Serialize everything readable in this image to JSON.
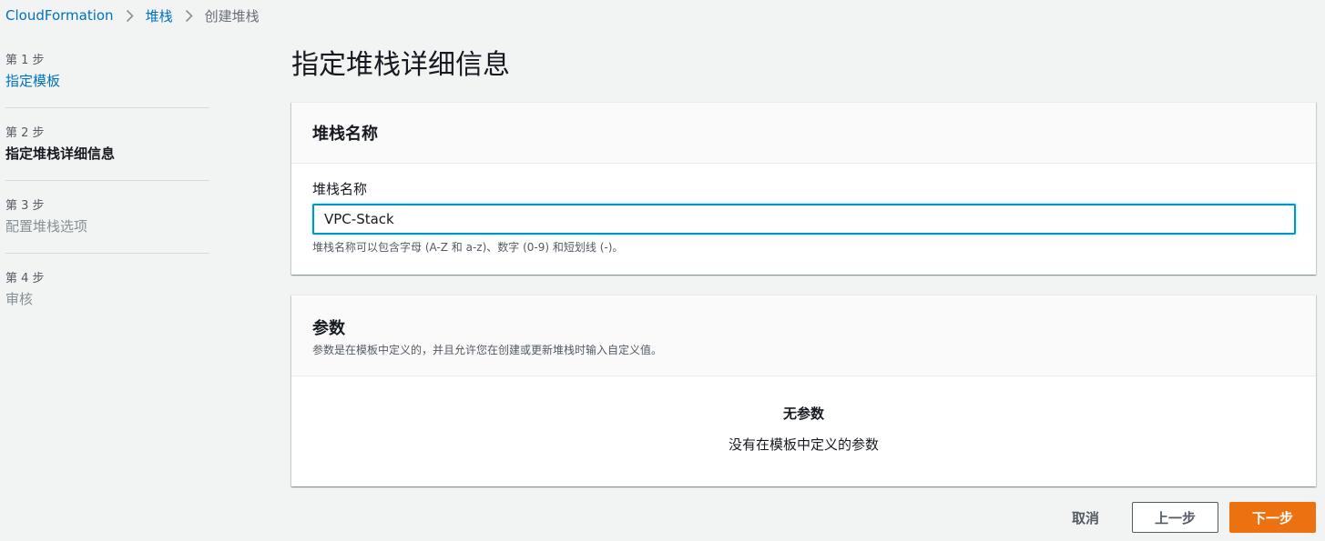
{
  "breadcrumb": {
    "items": [
      {
        "label": "CloudFormation"
      },
      {
        "label": "堆栈"
      },
      {
        "label": "创建堆栈"
      }
    ]
  },
  "steps": [
    {
      "number": "第 1 步",
      "label": "指定模板"
    },
    {
      "number": "第 2 步",
      "label": "指定堆栈详细信息"
    },
    {
      "number": "第 3 步",
      "label": "配置堆栈选项"
    },
    {
      "number": "第 4 步",
      "label": "审核"
    }
  ],
  "page": {
    "title": "指定堆栈详细信息"
  },
  "stack_name_panel": {
    "header": "堆栈名称",
    "field_label": "堆栈名称",
    "value": "VPC-Stack",
    "hint": "堆栈名称可以包含字母 (A-Z 和 a-z)、数字 (0-9) 和短划线 (-)。"
  },
  "parameters_panel": {
    "header": "参数",
    "description": "参数是在模板中定义的，并且允许您在创建或更新堆栈时输入自定义值。",
    "empty_title": "无参数",
    "empty_description": "没有在模板中定义的参数"
  },
  "actions": {
    "cancel": "取消",
    "previous": "上一步",
    "next": "下一步"
  },
  "colors": {
    "link": "#0073bb",
    "primary_button": "#ec7211",
    "input_focus": "#0097c8",
    "background": "#f2f3f3"
  },
  "icons": {
    "breadcrumb_separator": "chevron-right-icon"
  }
}
